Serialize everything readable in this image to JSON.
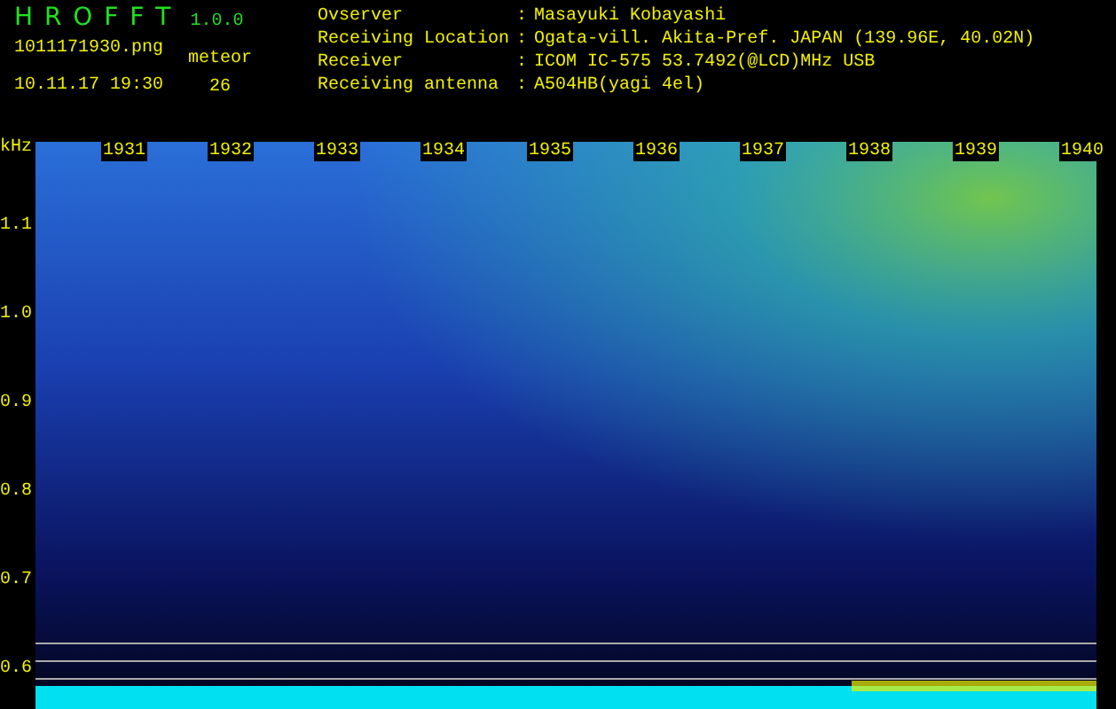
{
  "header": {
    "app_name": "H R O F F T",
    "version": "1.0.0",
    "filename": "1011171930.png",
    "datetime": "10.11.17 19:30",
    "meteor_label": "meteor",
    "meteor_count": "26"
  },
  "station": [
    {
      "label": "Ovserver",
      "value": "Masayuki Kobayashi"
    },
    {
      "label": "Receiving Location",
      "value": "Ogata-vill. Akita-Pref. JAPAN (139.96E, 40.02N)"
    },
    {
      "label": "Receiver",
      "value": "ICOM IC-575 53.7492(@LCD)MHz USB"
    },
    {
      "label": "Receiving antenna",
      "value": "A504HB(yagi 4el)"
    }
  ],
  "separator": ":",
  "plot": {
    "y_unit": "kHz",
    "y_ticks": [
      "1.1",
      "1.0",
      "0.9",
      "0.8",
      "0.7",
      "0.6"
    ],
    "time_labels": [
      "1931",
      "1932",
      "1933",
      "1934",
      "1935",
      "1936",
      "1937",
      "1938",
      "1939",
      "1940"
    ]
  }
}
